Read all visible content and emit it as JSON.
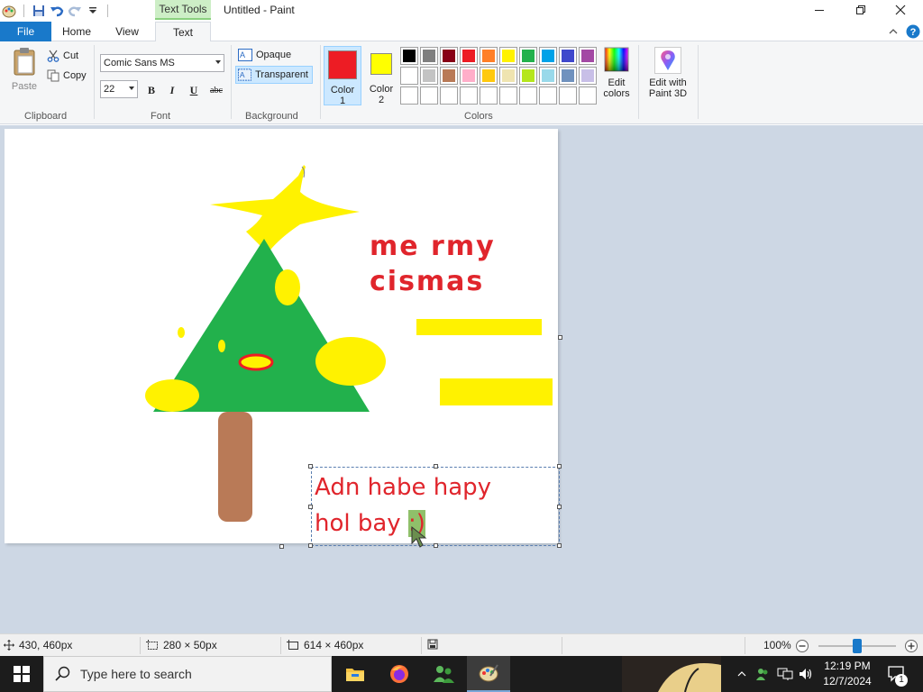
{
  "window": {
    "title": "Untitled - Paint",
    "contextual_tab": "Text Tools"
  },
  "tabs": {
    "file": "File",
    "home": "Home",
    "view": "View",
    "text": "Text"
  },
  "clipboard": {
    "paste": "Paste",
    "cut": "Cut",
    "copy": "Copy",
    "group_label": "Clipboard"
  },
  "font": {
    "family": "Comic Sans MS",
    "size": "22",
    "bold": "B",
    "italic": "I",
    "underline": "U",
    "strike": "abc",
    "group_label": "Font"
  },
  "background": {
    "opaque": "Opaque",
    "transparent": "Transparent",
    "group_label": "Background"
  },
  "colors": {
    "color1_label_1": "Color",
    "color1_label_2": "1",
    "color2_label_1": "Color",
    "color2_label_2": "2",
    "color1": "#ed1c24",
    "color2": "#ffff00",
    "edit_colors_1": "Edit",
    "edit_colors_2": "colors",
    "group_label": "Colors",
    "palette_row1": [
      "#000000",
      "#7f7f7f",
      "#880015",
      "#ed1c24",
      "#ff7f27",
      "#fff200",
      "#22b14c",
      "#00a2e8",
      "#3f48cc",
      "#a349a4"
    ],
    "palette_row2": [
      "#ffffff",
      "#c3c3c3",
      "#b97a57",
      "#ffaec9",
      "#ffc90e",
      "#efe4b0",
      "#b5e61d",
      "#99d9ea",
      "#7092be",
      "#c8bfe7"
    ]
  },
  "paint3d": {
    "line1": "Edit with",
    "line2": "Paint 3D"
  },
  "canvas": {
    "title_line1": "me rmy",
    "title_line2": "cismas",
    "text_line1": "Adn habe hapy",
    "text_line2": "hol bay",
    "text_smiley": ":)",
    "tree_green": "#22b14c",
    "trunk": "#b97a57",
    "yellow": "#fff200",
    "red": "#ed1c24"
  },
  "status": {
    "cursor_pos": "430, 460px",
    "selection_size": "280 × 50px",
    "image_size": "614 × 460px",
    "zoom": "100%"
  },
  "taskbar": {
    "search_placeholder": "Type here to search",
    "time": "12:19 PM",
    "date": "12/7/2024",
    "notification_count": "1"
  }
}
